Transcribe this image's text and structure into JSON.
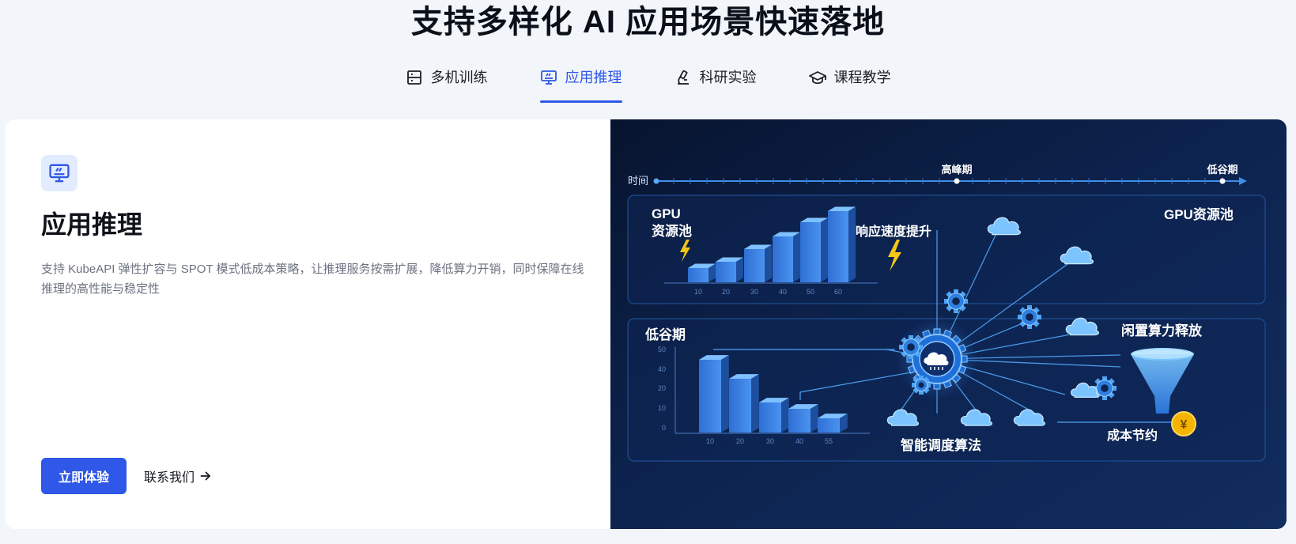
{
  "page": {
    "title": "支持多样化 AI 应用场景快速落地"
  },
  "tabs": [
    {
      "label": "多机训练",
      "icon": "server-icon",
      "active": false
    },
    {
      "label": "应用推理",
      "icon": "monitor-icon",
      "active": true
    },
    {
      "label": "科研实验",
      "icon": "microscope-icon",
      "active": false
    },
    {
      "label": "课程教学",
      "icon": "graduation-cap-icon",
      "active": false
    }
  ],
  "feature": {
    "icon": "monitor-icon",
    "title": "应用推理",
    "description": "支持 KubeAPI 弹性扩容与 SPOT 模式低成本策略，让推理服务按需扩展，降低算力开销，同时保障在线推理的高性能与稳定性",
    "primary_button": "立即体验",
    "contact_link": "联系我们"
  },
  "illustration": {
    "timeline_label": "时间",
    "peak_label": "高峰期",
    "valley_label": "低谷期",
    "gpu_pool_left": [
      "GPU",
      "资源池"
    ],
    "gpu_pool_right": "GPU资源池",
    "response_label": "响应速度提升",
    "valley_section_label": "低谷期",
    "idle_release_label": "闲置算力释放",
    "scheduler_label": "智能调度算法",
    "cost_saving_label": "成本节约",
    "upper_chart_ticks": [
      "10",
      "20",
      "30",
      "40",
      "50",
      "60"
    ],
    "lower_chart_xticks": [
      "10",
      "20",
      "30",
      "40",
      "55"
    ],
    "lower_chart_yticks": [
      "50",
      "40",
      "20",
      "10",
      "0"
    ],
    "yen_symbol": "¥",
    "colors": {
      "accent": "#2f57e8",
      "bg_dark": "#0c1a3a",
      "bar_blue": "#3b7ddd",
      "lightning": "#f5c518",
      "coin": "#f5b400"
    }
  }
}
